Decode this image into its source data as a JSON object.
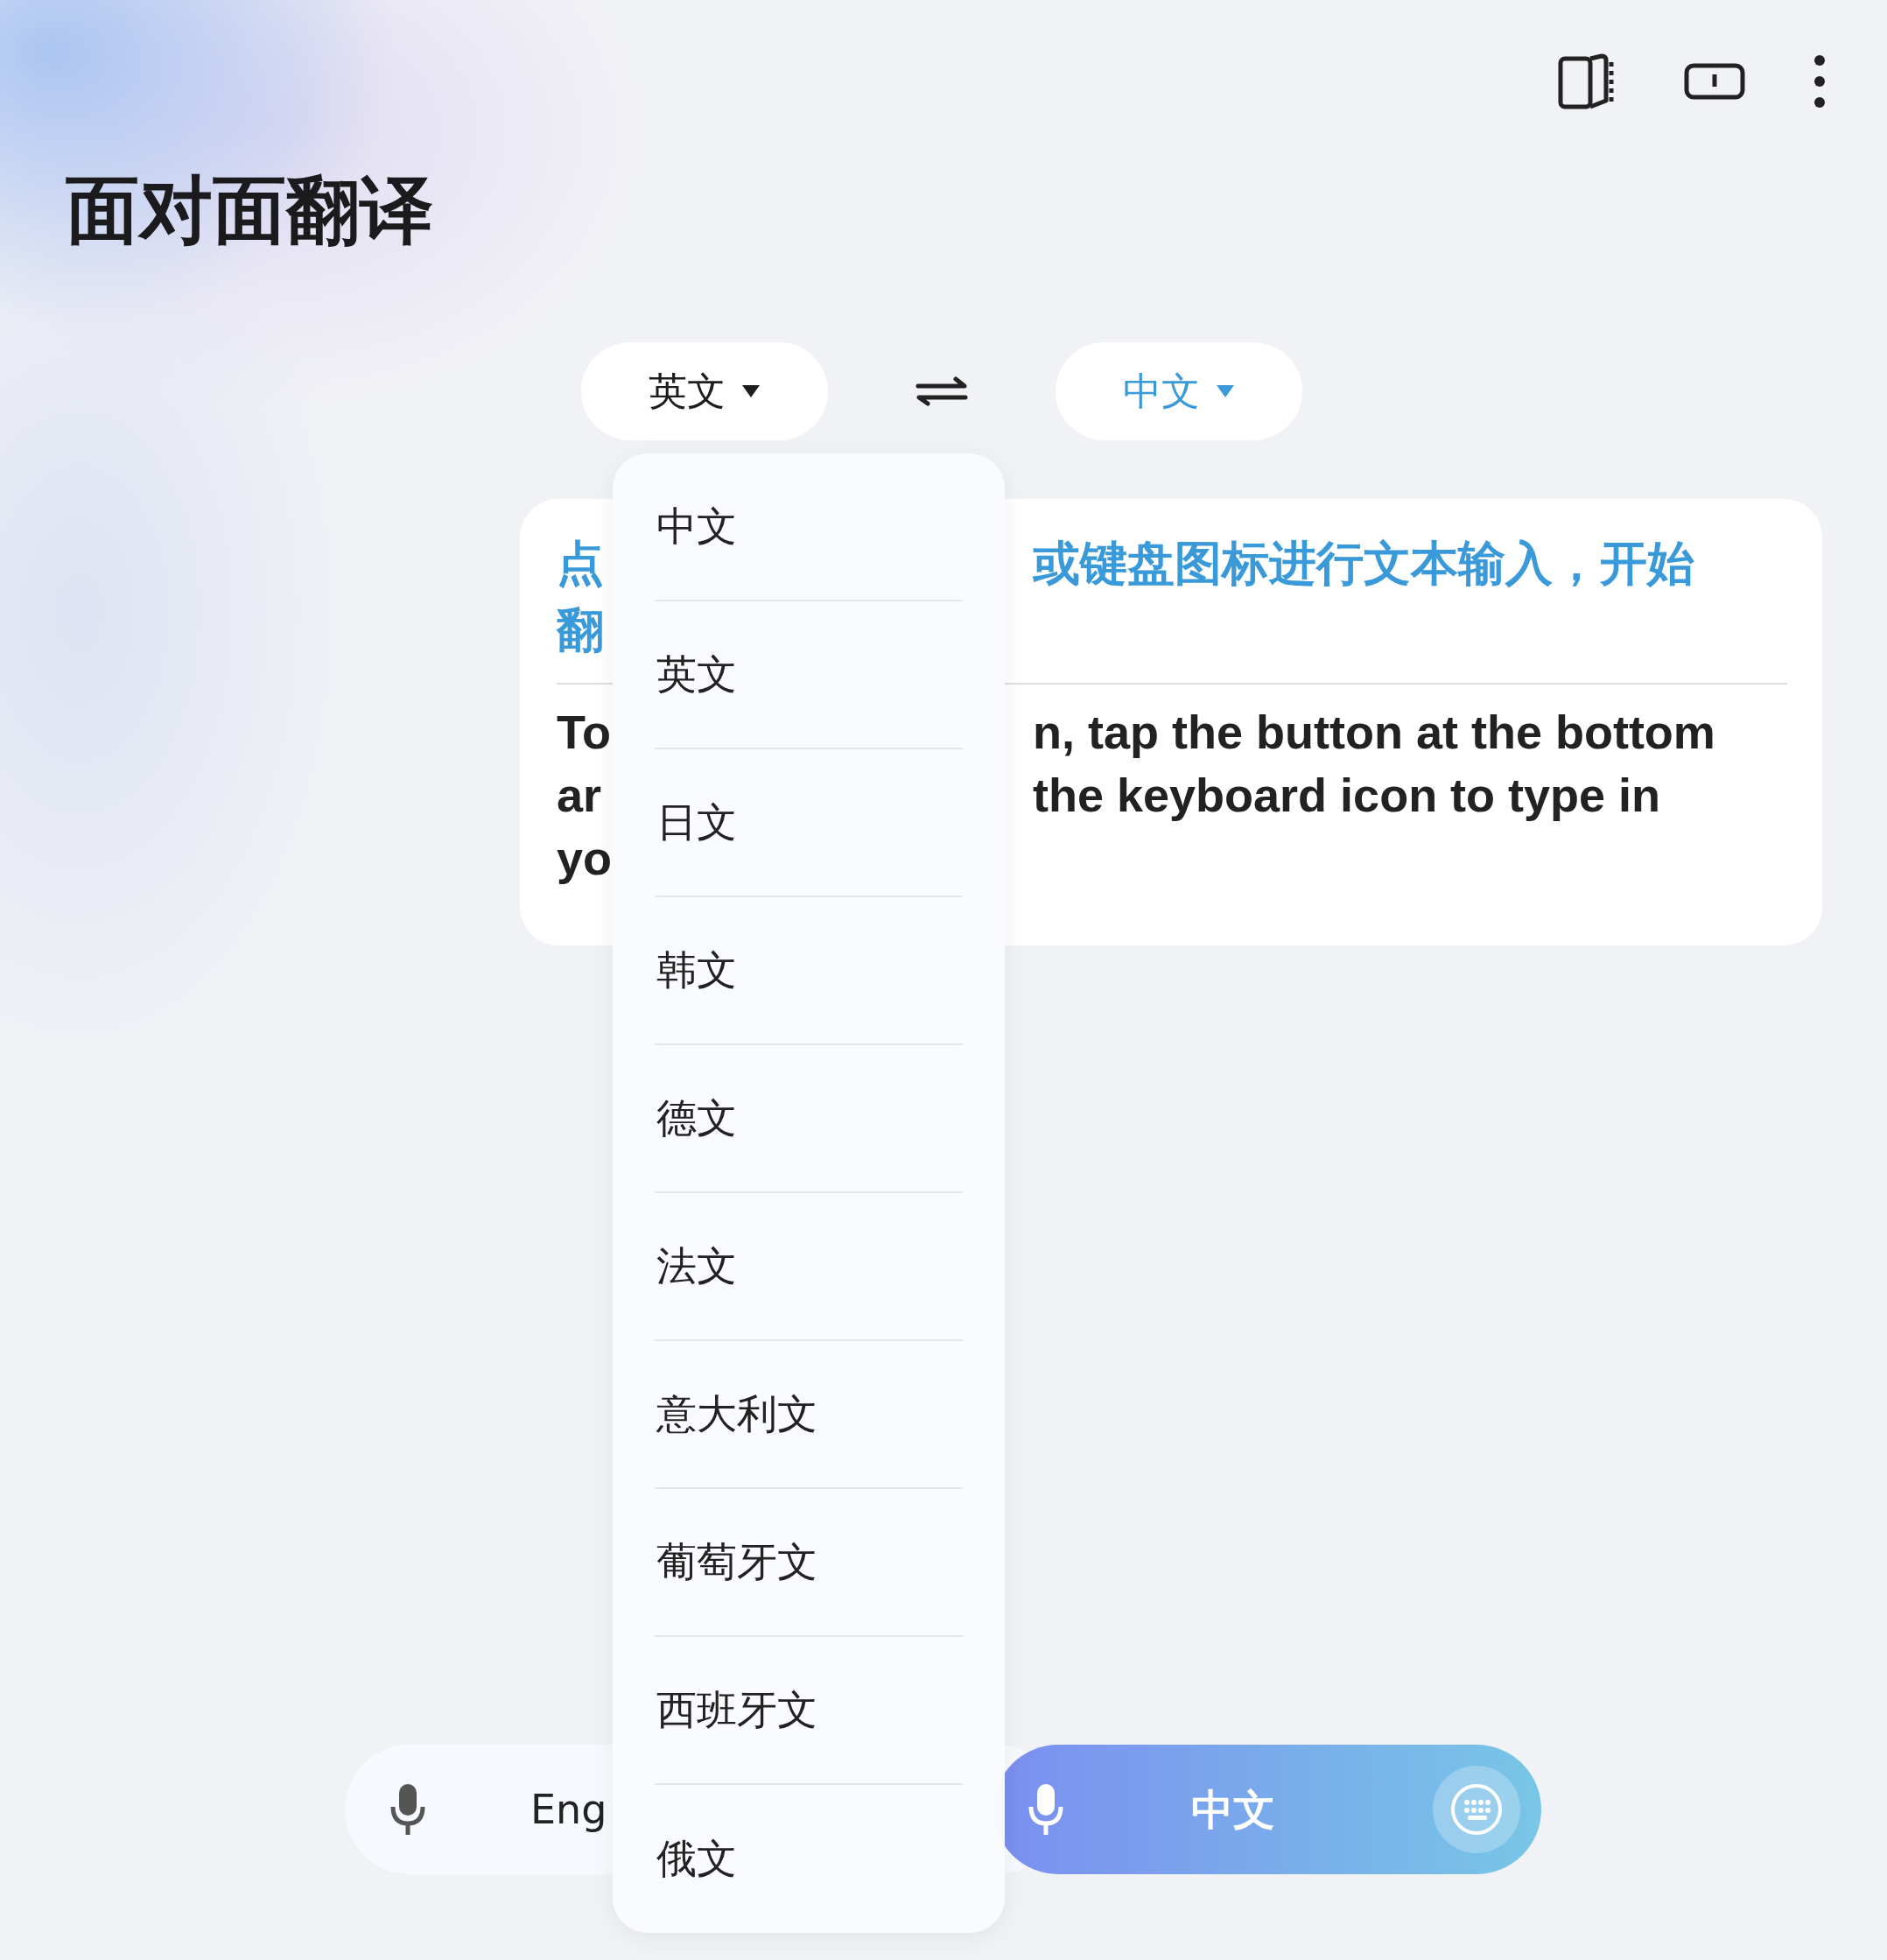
{
  "header": {
    "title": "面对面翻译",
    "toolbar": [
      {
        "kind": "split"
      },
      {
        "kind": "single"
      },
      {
        "kind": "more"
      }
    ]
  },
  "language_bar": {
    "source": {
      "label": "英文"
    },
    "target": {
      "label": "中文"
    }
  },
  "prompt_card": {
    "chinese_lines": [
      {
        "left": "点",
        "right": "或键盘图标进行文本输入，开始"
      },
      {
        "left": "翻"
      }
    ],
    "english_lines": [
      {
        "left": "To",
        "right": "n, tap the button at the bottom"
      },
      {
        "left": "ar",
        "right": "the keyboard icon to type in"
      },
      {
        "left": "yo"
      }
    ]
  },
  "language_menu": {
    "items": [
      {
        "label": "中文"
      },
      {
        "label": "英文"
      },
      {
        "label": "日文"
      },
      {
        "label": "韩文"
      },
      {
        "label": "德文"
      },
      {
        "label": "法文"
      },
      {
        "label": "意大利文"
      },
      {
        "label": "葡萄牙文"
      },
      {
        "label": "西班牙文"
      },
      {
        "label": "俄文"
      }
    ]
  },
  "bottom_bar": {
    "left": {
      "label": "Eng"
    },
    "right": {
      "label": "中文"
    }
  }
}
